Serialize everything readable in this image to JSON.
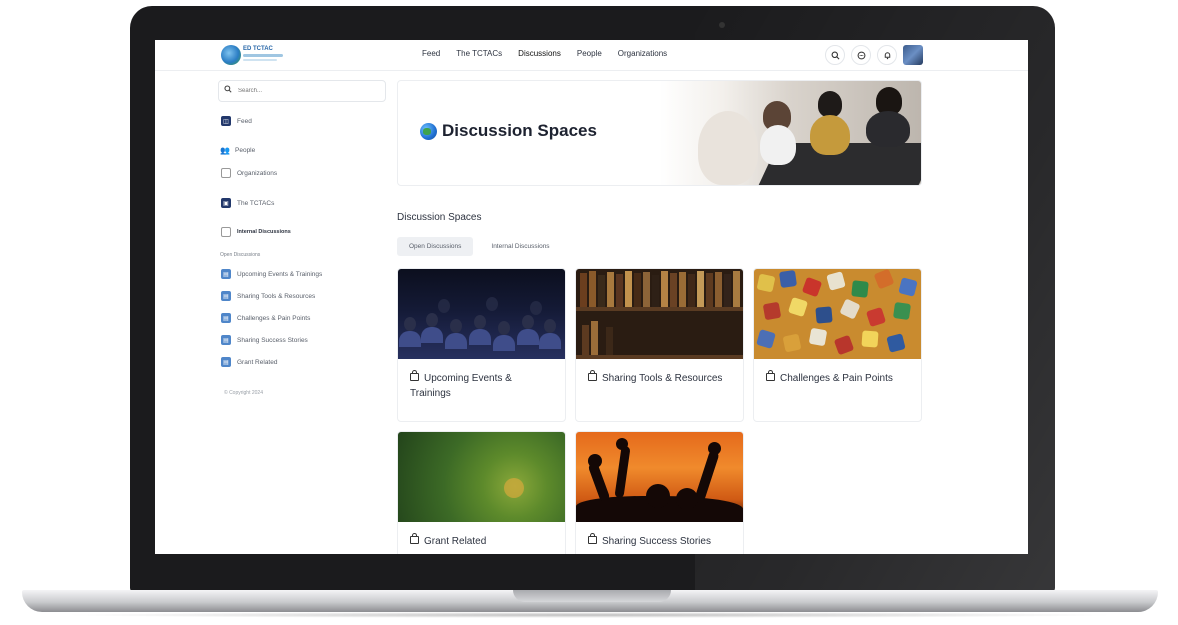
{
  "app": {
    "logo_text": "ED TCTAC"
  },
  "nav": {
    "items": [
      {
        "label": "Feed"
      },
      {
        "label": "The TCTACs"
      },
      {
        "label": "Discussions"
      },
      {
        "label": "People"
      },
      {
        "label": "Organizations"
      }
    ]
  },
  "top_icons": [
    "search-icon",
    "chat-icon",
    "bell-icon",
    "avatar"
  ],
  "sidebar": {
    "search_placeholder": "Search...",
    "feed": "Feed",
    "people": "People",
    "organizations": "Organizations",
    "tctacs": "The TCTACs",
    "internal": "Internal Discussions",
    "open_heading": "Open Discussions",
    "open_items": [
      {
        "label": "Upcoming Events & Trainings"
      },
      {
        "label": "Sharing Tools & Resources"
      },
      {
        "label": "Challenges & Pain Points"
      },
      {
        "label": "Sharing Success Stories"
      },
      {
        "label": "Grant Related"
      }
    ],
    "copyright": "© Copyright 2024"
  },
  "banner": {
    "title": "Discussion Spaces"
  },
  "main": {
    "section_title": "Discussion Spaces",
    "tabs": [
      {
        "label": "Open Discussions",
        "active": true
      },
      {
        "label": "Internal Discussions",
        "active": false
      }
    ],
    "cards": [
      {
        "title": "Upcoming Events & Trainings",
        "image": "audience"
      },
      {
        "title": "Sharing Tools & Resources",
        "image": "books"
      },
      {
        "title": "Challenges & Pain Points",
        "image": "puzzle"
      },
      {
        "title": "Grant Related",
        "image": "green-bokeh"
      },
      {
        "title": "Sharing Success Stories",
        "image": "sunset-hands"
      }
    ]
  },
  "colors": {
    "accent": "#22386b",
    "sidebar_icon": "#4f86c9",
    "text": "#2d3340",
    "muted": "#5a606b"
  }
}
